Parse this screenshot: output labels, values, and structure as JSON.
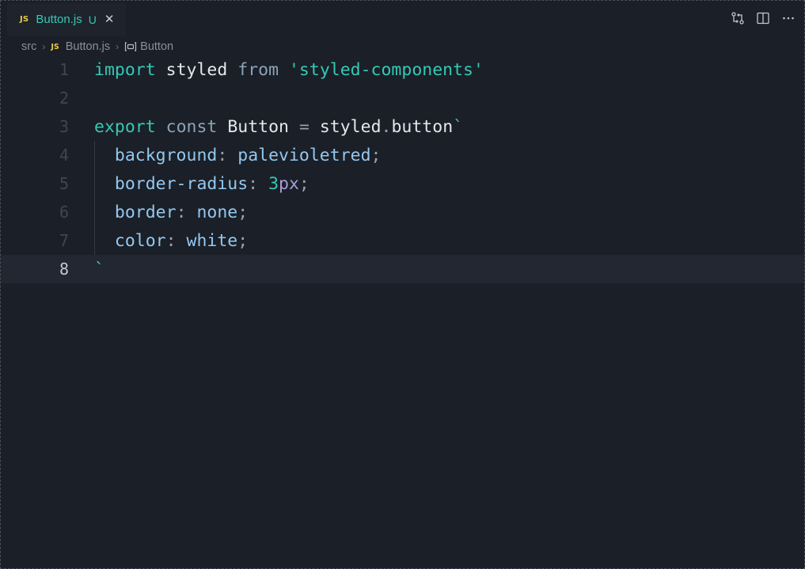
{
  "tab": {
    "badge": "JS",
    "title": "Button.js",
    "status": "U",
    "close": "✕"
  },
  "breadcrumb": {
    "folder": "src",
    "file_badge": "JS",
    "file": "Button.js",
    "symbol": "Button"
  },
  "editor": {
    "current_line": 8,
    "lines": [
      {
        "n": "1",
        "tokens": [
          [
            "kw",
            "import"
          ],
          [
            "sp",
            " "
          ],
          [
            "id",
            "styled"
          ],
          [
            "sp",
            " "
          ],
          [
            "kw2",
            "from"
          ],
          [
            "sp",
            " "
          ],
          [
            "str",
            "'styled-components'"
          ]
        ]
      },
      {
        "n": "2",
        "tokens": []
      },
      {
        "n": "3",
        "tokens": [
          [
            "kw",
            "export"
          ],
          [
            "sp",
            " "
          ],
          [
            "kw2",
            "const"
          ],
          [
            "sp",
            " "
          ],
          [
            "id",
            "Button"
          ],
          [
            "sp",
            " "
          ],
          [
            "punc",
            "="
          ],
          [
            "sp",
            " "
          ],
          [
            "id",
            "styled"
          ],
          [
            "punc",
            "."
          ],
          [
            "id",
            "button"
          ],
          [
            "tick",
            "`"
          ]
        ]
      },
      {
        "n": "4",
        "tokens": [
          [
            "sp",
            "  "
          ],
          [
            "prop",
            "background"
          ],
          [
            "punc",
            ":"
          ],
          [
            "sp",
            " "
          ],
          [
            "val",
            "palevioletred"
          ],
          [
            "punc",
            ";"
          ]
        ]
      },
      {
        "n": "5",
        "tokens": [
          [
            "sp",
            "  "
          ],
          [
            "prop",
            "border-radius"
          ],
          [
            "punc",
            ":"
          ],
          [
            "sp",
            " "
          ],
          [
            "num",
            "3"
          ],
          [
            "unit",
            "px"
          ],
          [
            "punc",
            ";"
          ]
        ]
      },
      {
        "n": "6",
        "tokens": [
          [
            "sp",
            "  "
          ],
          [
            "prop",
            "border"
          ],
          [
            "punc",
            ":"
          ],
          [
            "sp",
            " "
          ],
          [
            "val",
            "none"
          ],
          [
            "punc",
            ";"
          ]
        ]
      },
      {
        "n": "7",
        "tokens": [
          [
            "sp",
            "  "
          ],
          [
            "prop",
            "color"
          ],
          [
            "punc",
            ":"
          ],
          [
            "sp",
            " "
          ],
          [
            "val",
            "white"
          ],
          [
            "punc",
            ";"
          ]
        ]
      },
      {
        "n": "8",
        "tokens": [
          [
            "tick",
            "`"
          ]
        ]
      }
    ]
  },
  "actions": [
    {
      "name": "compare-changes-icon"
    },
    {
      "name": "split-editor-icon"
    },
    {
      "name": "more-actions-icon"
    }
  ],
  "colors": {
    "background": "#1b1f27",
    "accent": "#34c9b5",
    "js_badge": "#e6c84a"
  }
}
